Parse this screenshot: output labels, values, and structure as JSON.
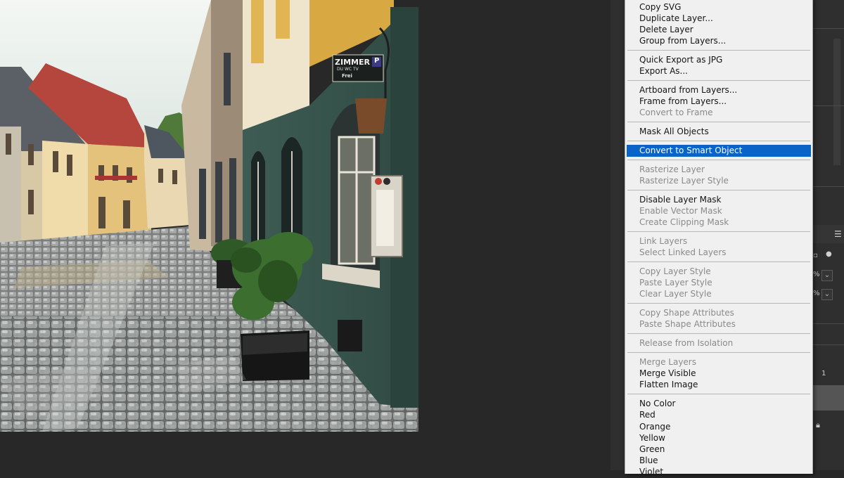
{
  "canvas": {
    "sign_text": "ZIMMER",
    "sign_sub": "DU WC TV",
    "sign_status": "Frei",
    "sign_badge": "P"
  },
  "context_menu": {
    "highlight_color": "#0a64c8",
    "items": [
      {
        "label": "Copy SVG",
        "enabled": true
      },
      {
        "label": "Duplicate Layer...",
        "enabled": true
      },
      {
        "label": "Delete Layer",
        "enabled": true
      },
      {
        "label": "Group from Layers...",
        "enabled": true
      },
      {
        "label": "Quick Export as JPG",
        "enabled": true
      },
      {
        "label": "Export As...",
        "enabled": true
      },
      {
        "label": "Artboard from Layers...",
        "enabled": true
      },
      {
        "label": "Frame from Layers...",
        "enabled": true
      },
      {
        "label": "Convert to Frame",
        "enabled": false
      },
      {
        "label": "Mask All Objects",
        "enabled": true
      },
      {
        "label": "Convert to Smart Object",
        "enabled": true,
        "highlighted": true
      },
      {
        "label": "Rasterize Layer",
        "enabled": false
      },
      {
        "label": "Rasterize Layer Style",
        "enabled": false
      },
      {
        "label": "Disable Layer Mask",
        "enabled": true
      },
      {
        "label": "Enable Vector Mask",
        "enabled": false
      },
      {
        "label": "Create Clipping Mask",
        "enabled": false
      },
      {
        "label": "Link Layers",
        "enabled": false
      },
      {
        "label": "Select Linked Layers",
        "enabled": false
      },
      {
        "label": "Copy Layer Style",
        "enabled": false
      },
      {
        "label": "Paste Layer Style",
        "enabled": false
      },
      {
        "label": "Clear Layer Style",
        "enabled": false
      },
      {
        "label": "Copy Shape Attributes",
        "enabled": false
      },
      {
        "label": "Paste Shape Attributes",
        "enabled": false
      },
      {
        "label": "Release from Isolation",
        "enabled": false
      },
      {
        "label": "Merge Layers",
        "enabled": false
      },
      {
        "label": "Merge Visible",
        "enabled": true
      },
      {
        "label": "Flatten Image",
        "enabled": true
      },
      {
        "label": "No Color",
        "enabled": true
      },
      {
        "label": "Red",
        "enabled": true
      },
      {
        "label": "Orange",
        "enabled": true
      },
      {
        "label": "Yellow",
        "enabled": true
      },
      {
        "label": "Green",
        "enabled": true
      },
      {
        "label": "Blue",
        "enabled": true
      },
      {
        "label": "Violet",
        "enabled": true
      }
    ]
  },
  "layers_panel": {
    "opacity_suffix": "%",
    "fill_suffix": "%",
    "layer_index": "1"
  }
}
